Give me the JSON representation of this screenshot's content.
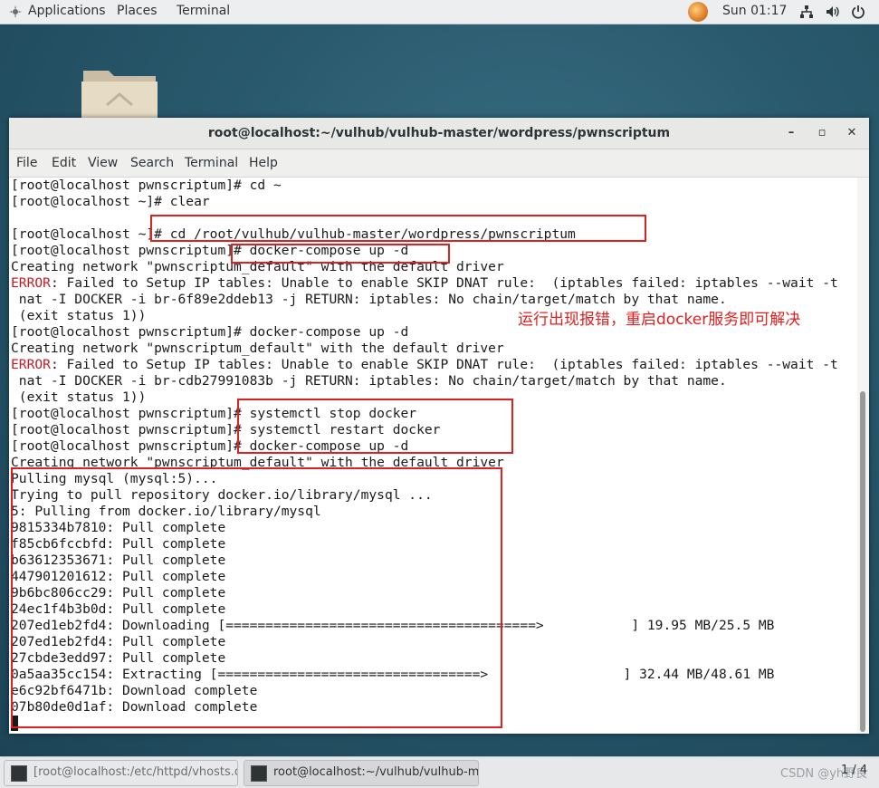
{
  "topbar": {
    "applications": "Applications",
    "places": "Places",
    "terminal": "Terminal",
    "clock": "Sun 01:17"
  },
  "window": {
    "title": "root@localhost:~/vulhub/vulhub-master/wordpress/pwnscriptum",
    "menu": [
      "File",
      "Edit",
      "View",
      "Search",
      "Terminal",
      "Help"
    ]
  },
  "terminal": {
    "lines": [
      "[root@localhost pwnscriptum]# cd ~",
      "[root@localhost ~]# clear",
      "",
      "[root@localhost ~]# cd /root/vulhub/vulhub-master/wordpress/pwnscriptum",
      "[root@localhost pwnscriptum]# docker-compose up -d",
      "Creating network \"pwnscriptum_default\" with the default driver",
      "ERROR: Failed to Setup IP tables: Unable to enable SKIP DNAT rule:  (iptables failed: iptables --wait -t",
      " nat -I DOCKER -i br-6f89e2ddeb13 -j RETURN: iptables: No chain/target/match by that name.",
      " (exit status 1))",
      "[root@localhost pwnscriptum]# docker-compose up -d",
      "Creating network \"pwnscriptum_default\" with the default driver",
      "ERROR: Failed to Setup IP tables: Unable to enable SKIP DNAT rule:  (iptables failed: iptables --wait -t",
      " nat -I DOCKER -i br-cdb27991083b -j RETURN: iptables: No chain/target/match by that name.",
      " (exit status 1))",
      "[root@localhost pwnscriptum]# systemctl stop docker",
      "[root@localhost pwnscriptum]# systemctl restart docker",
      "[root@localhost pwnscriptum]# docker-compose up -d",
      "Creating network \"pwnscriptum_default\" with the default driver",
      "Pulling mysql (mysql:5)...",
      "Trying to pull repository docker.io/library/mysql ...",
      "5: Pulling from docker.io/library/mysql",
      "9815334b7810: Pull complete",
      "f85cb6fccbfd: Pull complete",
      "b63612353671: Pull complete",
      "447901201612: Pull complete",
      "9b6bc806cc29: Pull complete",
      "24ec1f4b3b0d: Pull complete",
      "207ed1eb2fd4: Downloading [=======================================>           ] 19.95 MB/25.5 MB",
      "207ed1eb2fd4: Pull complete",
      "27cbde3edd97: Pull complete",
      "0a5aa35cc154: Extracting [=================================>                 ] 32.44 MB/48.61 MB",
      "e6c92bf6471b: Download complete",
      "07b80de0d1af: Download complete"
    ],
    "error_word": "ERROR"
  },
  "annotation": "运行出现报错，重启docker服务即可解决",
  "taskbar": {
    "task1": "[root@localhost:/etc/httpd/vhosts.d]",
    "task2": "root@localhost:~/vulhub/vulhub-ma...",
    "watermark": "CSDN @yh野良",
    "page": "1 / 4"
  },
  "colors": {
    "error": "#c01c28",
    "highlight_box": "#e0201f"
  }
}
